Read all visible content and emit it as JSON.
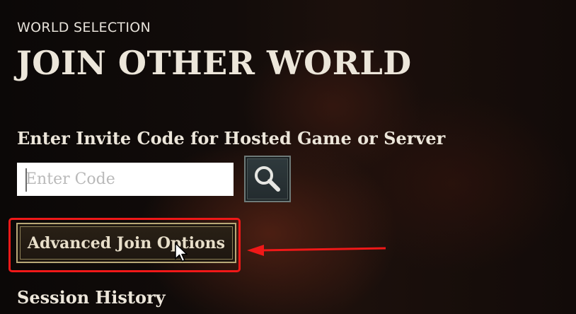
{
  "header": {
    "section_label": "WORLD SELECTION",
    "title": "JOIN OTHER WORLD"
  },
  "invite": {
    "label": "Enter Invite Code for Hosted Game or Server",
    "input_placeholder": "Enter Code",
    "input_value": "",
    "search_icon": "magnifier-icon"
  },
  "advanced": {
    "label": "Advanced Join Options"
  },
  "session_history": {
    "label": "Session History"
  },
  "annotations": {
    "highlight_color": "#f01818",
    "arrow_color": "#f01818"
  }
}
